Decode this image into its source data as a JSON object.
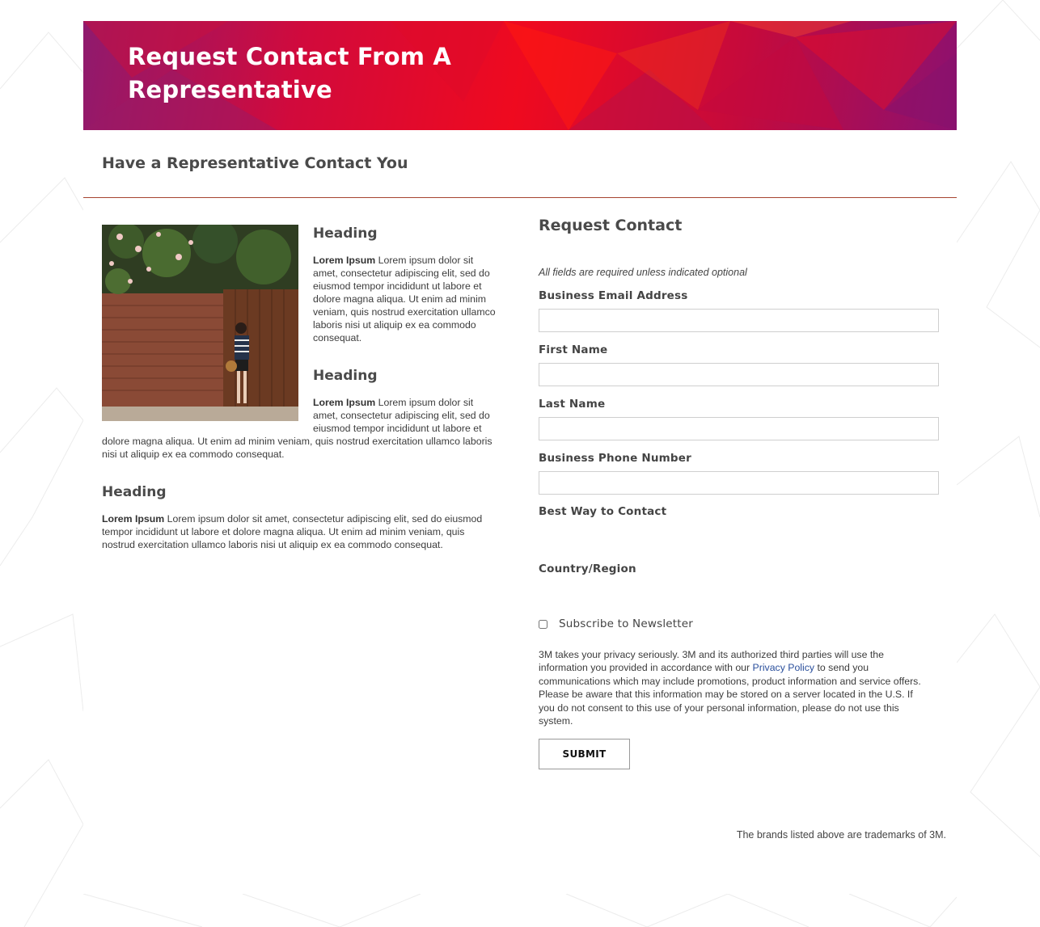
{
  "banner": {
    "title": "Request Contact From A Representative"
  },
  "subheader": {
    "title": "Have a Representative Contact You"
  },
  "left": {
    "blocks": [
      {
        "heading": "Heading",
        "lead": "Lorem Ipsum",
        "body": " Lorem ipsum dolor sit amet, consectetur adipiscing elit, sed do eiusmod tempor incididunt ut labore et dolore magna aliqua. Ut enim ad minim veniam, quis nostrud exercitation ullamco laboris nisi ut aliquip ex ea commodo consequat."
      },
      {
        "heading": "Heading",
        "lead": "Lorem Ipsum",
        "body": " Lorem ipsum dolor sit amet, consectetur adipiscing elit, sed do eiusmod tempor incididunt ut labore et dolore magna aliqua. Ut enim ad minim veniam, quis nostrud exercitation ullamco laboris nisi ut aliquip ex ea commodo consequat."
      },
      {
        "heading": "Heading",
        "lead": "Lorem Ipsum",
        "body": " Lorem ipsum dolor sit amet, consectetur adipiscing elit, sed do eiusmod tempor incididunt ut labore et dolore magna aliqua. Ut enim ad minim veniam, quis nostrud exercitation ullamco laboris nisi ut aliquip ex ea commodo consequat."
      }
    ]
  },
  "form": {
    "title": "Request Contact",
    "required_note": "All fields are required unless indicated optional",
    "fields": {
      "email": {
        "label": "Business Email Address",
        "value": ""
      },
      "first_name": {
        "label": "First Name",
        "value": ""
      },
      "last_name": {
        "label": "Last Name",
        "value": ""
      },
      "phone": {
        "label": "Business Phone Number",
        "value": ""
      }
    },
    "best_way_label": "Best Way to Contact",
    "country_label": "Country/Region",
    "newsletter_label": "Subscribe to Newsletter",
    "newsletter_checked": false,
    "privacy_before": "3M takes your privacy seriously. 3M and its authorized third parties will use the information you provided in accordance with our ",
    "privacy_link": "Privacy Policy",
    "privacy_after": " to send you communications which may include promotions, product information and service offers. Please be aware that this information may be stored on a server located in the U.S. If you do not consent to this use of your personal information, please do not use this system.",
    "submit_label": "SUBMIT"
  },
  "footer": {
    "note": "The brands listed above are trademarks of 3M."
  },
  "colors": {
    "banner_red": "#ef0a1f",
    "banner_purple": "#8f1a6e",
    "divider": "#a5432f",
    "link": "#2a4f9c"
  }
}
